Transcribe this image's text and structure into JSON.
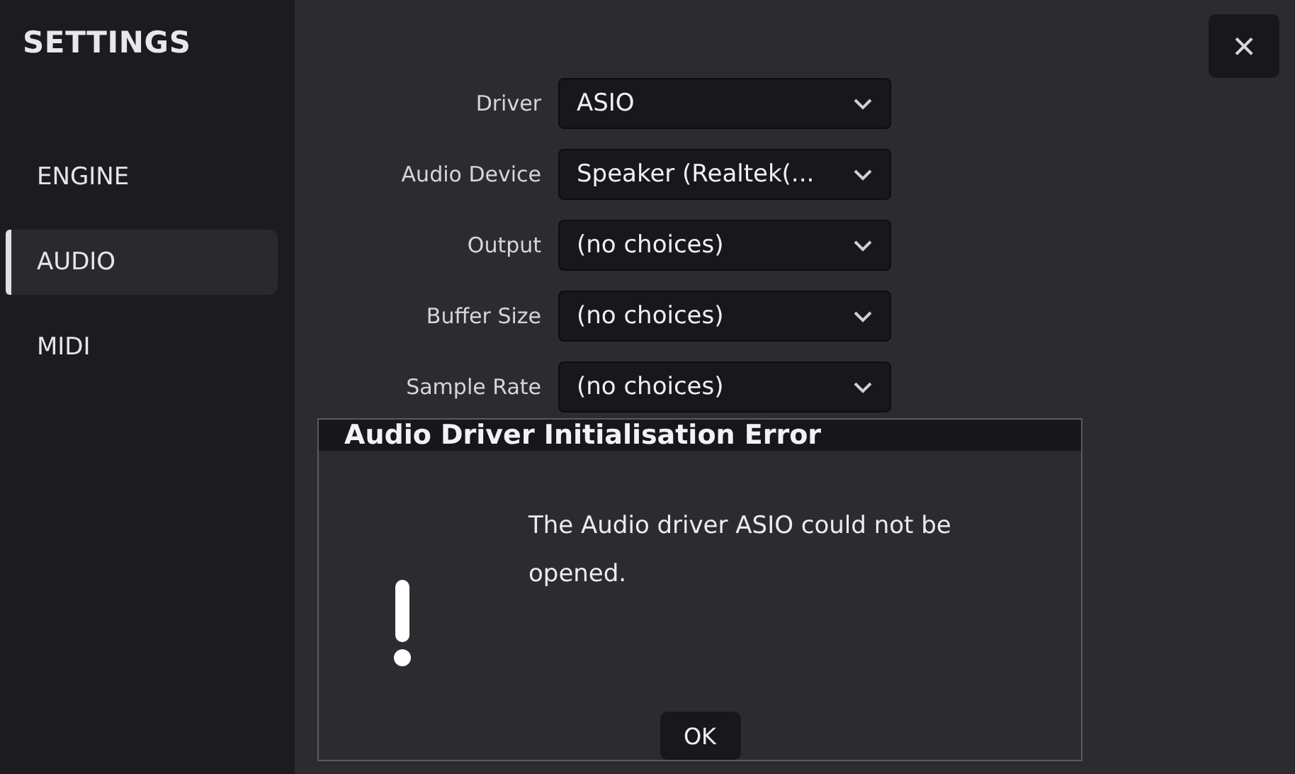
{
  "sidebar": {
    "title": "SETTINGS",
    "items": [
      {
        "label": "ENGINE",
        "selected": false
      },
      {
        "label": "AUDIO",
        "selected": true
      },
      {
        "label": "MIDI",
        "selected": false
      }
    ]
  },
  "close_button": "×",
  "audio_settings": [
    {
      "label": "Driver",
      "value": "ASIO"
    },
    {
      "label": "Audio Device",
      "value": "Speaker (Realtek(..."
    },
    {
      "label": "Output",
      "value": "(no choices)"
    },
    {
      "label": "Buffer Size",
      "value": "(no choices)"
    },
    {
      "label": "Sample Rate",
      "value": "(no choices)"
    }
  ],
  "dialog": {
    "title": "Audio Driver Initialisation Error",
    "message": "The Audio driver ASIO could not be opened.",
    "buttons": [
      "OK"
    ]
  }
}
